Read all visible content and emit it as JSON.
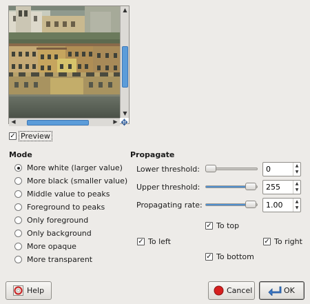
{
  "preview": {
    "checkbox_checked": true,
    "label": "Preview",
    "vscroll_position": 0.45,
    "hscroll_position": 0.22
  },
  "mode": {
    "title": "Mode",
    "options": [
      {
        "label": "More white (larger value)",
        "selected": true
      },
      {
        "label": "More black (smaller value)",
        "selected": false
      },
      {
        "label": "Middle value to peaks",
        "selected": false
      },
      {
        "label": "Foreground to peaks",
        "selected": false
      },
      {
        "label": "Only foreground",
        "selected": false
      },
      {
        "label": "Only background",
        "selected": false
      },
      {
        "label": "More opaque",
        "selected": false
      },
      {
        "label": "More transparent",
        "selected": false
      }
    ]
  },
  "propagate": {
    "title": "Propagate",
    "lower": {
      "label": "Lower threshold:",
      "value": "0",
      "fraction": 0.0
    },
    "upper": {
      "label": "Upper threshold:",
      "value": "255",
      "fraction": 1.0
    },
    "rate": {
      "label": "Propagating rate:",
      "value": "1.00",
      "fraction": 1.0
    },
    "to_top": {
      "label": "To top",
      "checked": true
    },
    "to_left": {
      "label": "To left",
      "checked": true
    },
    "to_right": {
      "label": "To right",
      "checked": true
    },
    "to_bottom": {
      "label": "To bottom",
      "checked": true
    }
  },
  "buttons": {
    "help": "Help",
    "cancel": "Cancel",
    "ok": "OK"
  },
  "colors": {
    "accent": "#4f8fd0",
    "cancel_icon": "#d61f1f",
    "ok_icon": "#3a78c8"
  }
}
